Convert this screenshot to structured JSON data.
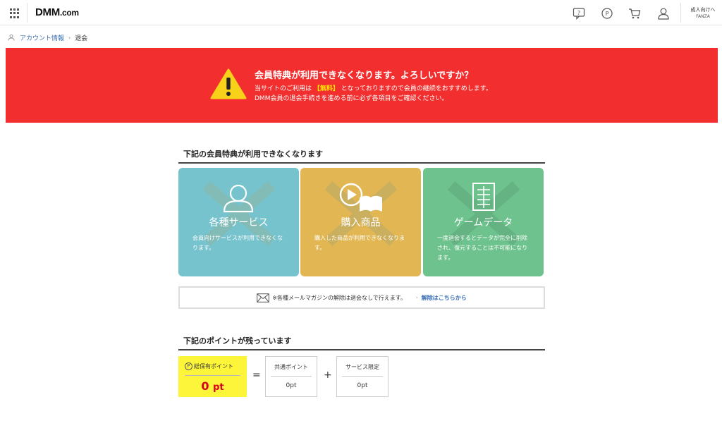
{
  "header": {
    "logo_main": "DMM",
    "logo_domain": ".com",
    "adult_link_label": "成人向けへ",
    "adult_link_sub": "FANZA"
  },
  "breadcrumb": {
    "account": "アカウント情報",
    "separator": "›",
    "current": "退会"
  },
  "banner": {
    "title": "会員特典が利用できなくなります。よろしいですか？",
    "line1_before": "当サイトのご利用は",
    "line1_free": "【無料】",
    "line1_after": "となっておりますので会員の継続をおすすめします。",
    "line2": "DMM会員の退会手続きを進める前に必ず各項目をご確認ください。",
    "color": "#f22e2e"
  },
  "benefits": {
    "heading": "下記の会員特典が利用できなくなります",
    "cards": [
      {
        "title": "各種サービス",
        "desc": "会員向けサービスが利用できなくなります。",
        "color": "#76c3cd",
        "icon": "user-icon"
      },
      {
        "title": "購入商品",
        "desc": "購入した商品が利用できなくなります。",
        "color": "#e2b753",
        "icon": "video-book-icon"
      },
      {
        "title": "ゲームデータ",
        "desc": "一度退会するとデータが完全に削除され、復元することは不可能になります。",
        "color": "#6dc28d",
        "icon": "notebook-icon"
      }
    ]
  },
  "mail": {
    "text": "※各種メールマガジンの解除は退会なしで行えます。",
    "arrow": "›",
    "link": "解除はこちらから"
  },
  "points": {
    "heading": "下記のポイントが残っています",
    "total_label": "総保有ポイント",
    "total_icon_letter": "P",
    "total_value": "0",
    "total_unit": "pt",
    "equals": "=",
    "plus": "+",
    "common_label": "共通ポイント",
    "common_value": "0pt",
    "service_label": "サービス限定",
    "service_value": "0pt"
  }
}
